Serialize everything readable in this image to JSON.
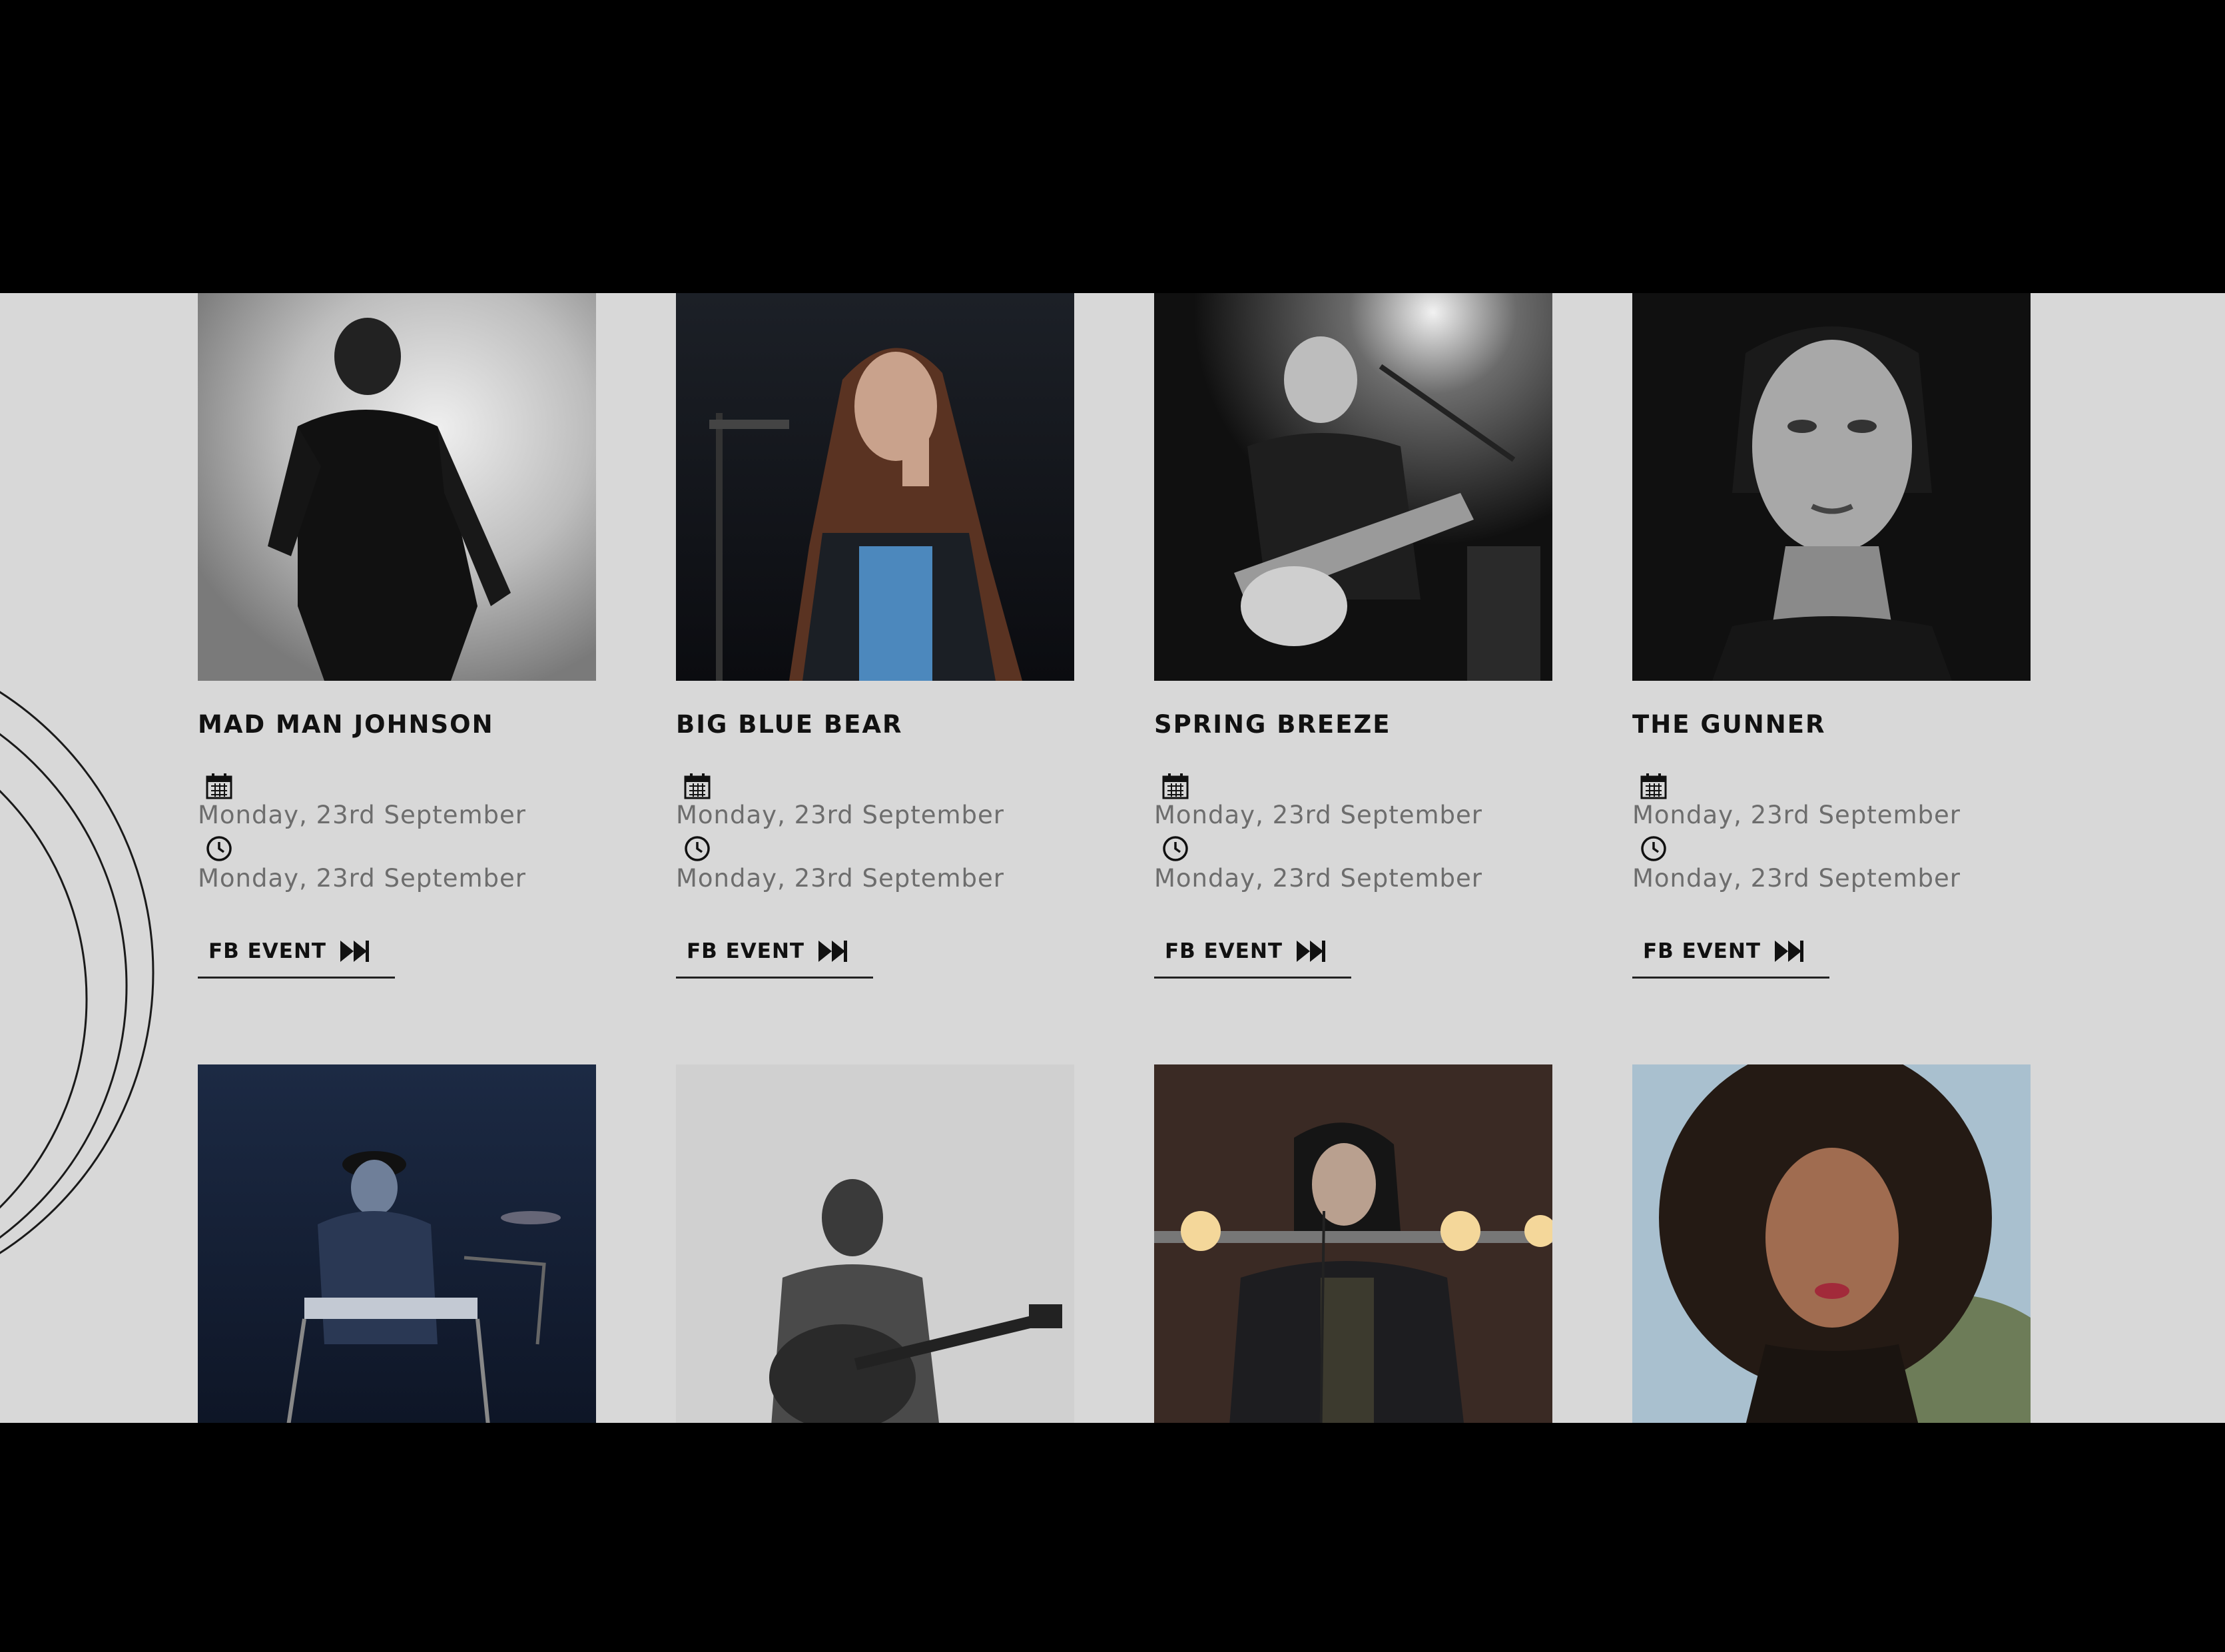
{
  "events": [
    {
      "name": "MAD MAN JOHNSON",
      "date": "Monday, 23rd September",
      "time": "Monday, 23rd September",
      "link": "FB EVENT",
      "photo": "performer-silhouette-smoke"
    },
    {
      "name": "BIG BLUE BEAR",
      "date": "Monday, 23rd September",
      "time": "Monday, 23rd September",
      "link": "FB EVENT",
      "photo": "singer-with-microphone"
    },
    {
      "name": "SPRING BREEZE",
      "date": "Monday, 23rd September",
      "time": "Monday, 23rd September",
      "link": "FB EVENT",
      "photo": "guitarist-spotlight"
    },
    {
      "name": "THE GUNNER",
      "date": "Monday, 23rd September",
      "time": "Monday, 23rd September",
      "link": "FB EVENT",
      "photo": "portrait-woman-dark"
    }
  ],
  "second_row": [
    {
      "photo": "keyboardist-blue-stage"
    },
    {
      "photo": "acoustic-guitarist-bw"
    },
    {
      "photo": "singer-stage-lights"
    },
    {
      "photo": "portrait-curly-hair"
    }
  ],
  "colors": {
    "background": "#d8d8d8",
    "frame": "#000000",
    "text": "#111111",
    "muted": "#6d6d6d"
  },
  "icons": {
    "date": "calendar-icon",
    "time": "clock-icon",
    "link": "fast-forward-icon"
  }
}
